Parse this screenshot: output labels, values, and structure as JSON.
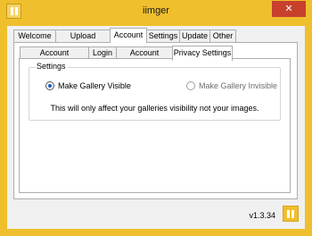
{
  "window": {
    "title": "iimger",
    "close_glyph": "✕"
  },
  "tabs": [
    "Welcome",
    "Upload Settings",
    "Account",
    "Settings",
    "Update",
    "Other"
  ],
  "active_tab": "Account",
  "subtabs": [
    "Account Information",
    "Login",
    "Account Creator",
    "Privacy Settings"
  ],
  "active_subtab": "Privacy Settings",
  "settings": {
    "group_label": "Settings",
    "option_visible": "Make Gallery Visible",
    "option_invisible": "Make Gallery Invisible",
    "selected": "visible",
    "note": "This will only affect your galleries visibility not your images."
  },
  "footer": {
    "version": "v1.3.34"
  },
  "colors": {
    "brand": "#f0bf2e",
    "close": "#c7402c",
    "selected_dot": "#1c5ec7"
  },
  "icons": {
    "app": "app-logo-icon",
    "close": "close-icon",
    "logo": "app-logo-icon"
  }
}
